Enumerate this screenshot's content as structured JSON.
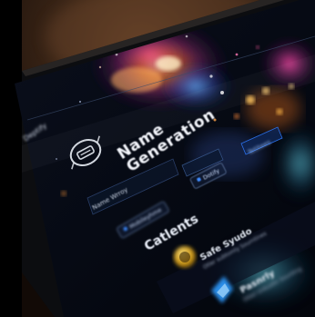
{
  "screen": {
    "app_name": "Deptify",
    "title_line1": "Name",
    "title_line2": "Generation",
    "field_label": "Name Wrroy",
    "chip_1": "Dotify",
    "chip_2": "Mobileyhme",
    "tab_label": "Tetitees",
    "section_title": "Catlents",
    "items": [
      {
        "name": "Safe Syudo",
        "subtitle": "Otler subtomly Sourntines"
      },
      {
        "name": "Pasnrly",
        "subtitle": "Otleii Unkuolin Sounting"
      }
    ]
  },
  "colors": {
    "background": "#0a0706",
    "screen": "#05070d",
    "accent_blue": "#2f7bff",
    "accent_orange": "#ff7a1a",
    "accent_magenta": "#ff3c8a",
    "gold_icon": "#d9a21a"
  }
}
